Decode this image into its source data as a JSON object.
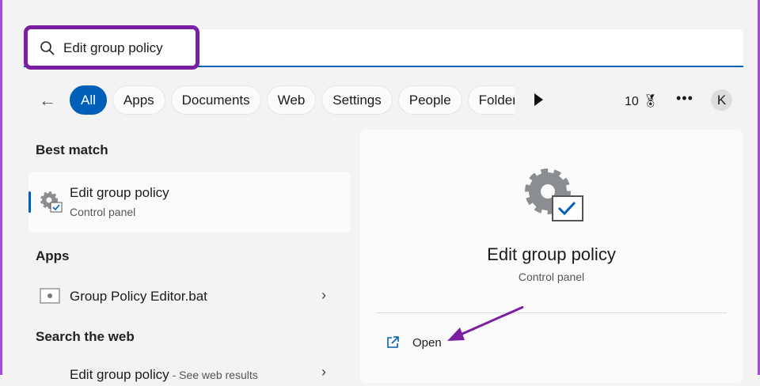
{
  "search": {
    "value": "Edit group policy"
  },
  "filters": [
    "All",
    "Apps",
    "Documents",
    "Web",
    "Settings",
    "People",
    "Folders"
  ],
  "rewards": {
    "points": "10"
  },
  "more_label": "•••",
  "avatar_initial": "K",
  "sections": {
    "best_match": "Best match",
    "apps": "Apps",
    "search_web": "Search the web"
  },
  "best_match": {
    "title": "Edit group policy",
    "subtitle": "Control panel"
  },
  "apps": [
    {
      "title": "Group Policy Editor.bat"
    }
  ],
  "web": [
    {
      "title": "Edit group policy",
      "subtitle": " - See web results"
    }
  ],
  "detail": {
    "title": "Edit group policy",
    "subtitle": "Control panel",
    "open_label": "Open"
  },
  "colors": {
    "accent": "#005fb8",
    "highlight": "#7a1fa2"
  }
}
